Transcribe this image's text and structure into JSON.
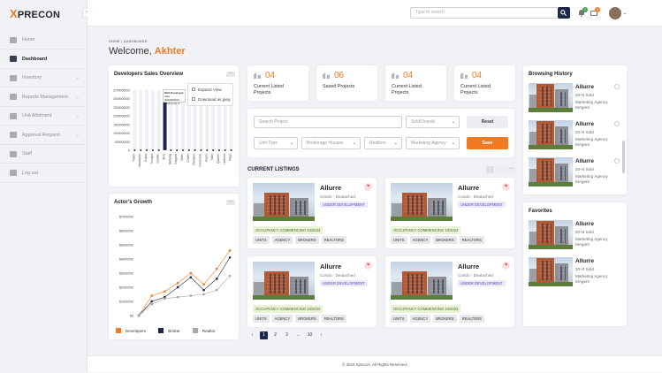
{
  "brand": {
    "logo_x": "X",
    "logo_text": "PRECON"
  },
  "sidebar": {
    "items": [
      {
        "label": "Home",
        "icon": "home-icon",
        "chevron": false
      },
      {
        "label": "Dashboard",
        "icon": "dashboard-icon",
        "chevron": false,
        "active": true
      },
      {
        "label": "Inventory",
        "icon": "inventory-icon",
        "chevron": true
      },
      {
        "label": "Reports Management",
        "icon": "reports-icon",
        "chevron": true
      },
      {
        "label": "Unit Allotment",
        "icon": "unit-icon",
        "chevron": true
      },
      {
        "label": "Approval Request",
        "icon": "approval-icon",
        "chevron": true
      },
      {
        "label": "Staff",
        "icon": "staff-icon",
        "chevron": false
      },
      {
        "label": "Log out",
        "icon": "logout-icon",
        "chevron": false
      }
    ]
  },
  "topbar": {
    "search_placeholder": "Type to search",
    "notif_count": "2",
    "msg_count": "3"
  },
  "breadcrumb": "HOME | DASHBOARD",
  "welcome": {
    "prefix": "Welcome,",
    "name": "Akhter"
  },
  "stats": [
    {
      "num": "04",
      "label": "Current Listed Projects"
    },
    {
      "num": "06",
      "label": "Saved Projects"
    },
    {
      "num": "04",
      "label": "Current Listed Projects"
    },
    {
      "num": "04",
      "label": "Current Listed Projects"
    }
  ],
  "sales": {
    "title": "Developers Sales Overview",
    "menu": [
      "Expand View",
      "Download as jpeg"
    ],
    "tooltip": [
      "BHS Developer",
      "Sale 3000000000",
      "Total Units: 3"
    ],
    "yticks": [
      "3700000000",
      "3000000000",
      "2500000000",
      "2000000000",
      "1500000000",
      "1000000000",
      "500000000",
      "0"
    ],
    "xticks": [
      "Tristar",
      "Hawthorne",
      "Gupta",
      "Triumph",
      "Granite",
      "BHS",
      "Mattamy",
      "Kingsett",
      "Minto",
      "Centre",
      "Phantom",
      "Fernbrook",
      "Aspen",
      "Talon",
      "Quarter",
      "Lanterra",
      "Plaza"
    ]
  },
  "chart_data": {
    "type": "bar",
    "title": "Developers Sales Overview",
    "categories": [
      "Tristar",
      "Hawthorne",
      "Gupta",
      "Triumph",
      "Granite",
      "BHS",
      "Mattamy",
      "Kingsett",
      "Minto",
      "Centre",
      "Phantom",
      "Fernbrook",
      "Aspen",
      "Talon",
      "Quarter",
      "Lanterra",
      "Plaza"
    ],
    "values": [
      0,
      0,
      0,
      0,
      0,
      3000000000,
      0,
      0,
      0,
      0,
      0,
      0,
      0,
      0,
      0,
      0,
      0
    ],
    "ylim": [
      0,
      3700000000
    ]
  },
  "growth": {
    "title": "Actor's Growth",
    "yticks": [
      "$7000000",
      "$6000000",
      "$5000000",
      "$4000000",
      "$3000000",
      "$2000000",
      "$1000000",
      "$0"
    ],
    "legend": [
      {
        "name": "Developers",
        "color": "#f27b21"
      },
      {
        "name": "Broker",
        "color": "#1e2749"
      },
      {
        "name": "Realtor",
        "color": "#a6a8ae"
      }
    ],
    "series": [
      {
        "name": "Developers",
        "values": [
          0,
          1400000,
          1700000,
          2300000,
          3000000,
          2200000,
          3300000,
          4600000
        ]
      },
      {
        "name": "Broker",
        "values": [
          0,
          1000000,
          1300000,
          2000000,
          2700000,
          1800000,
          2600000,
          4100000
        ]
      },
      {
        "name": "Realtor",
        "values": [
          0,
          800000,
          1200000,
          1300000,
          1400000,
          1500000,
          1800000,
          2800000
        ]
      }
    ]
  },
  "filters": {
    "search_project": "Search Project",
    "sold": "Sold/Unsold",
    "reset": "Reset",
    "unit_type": "Unit Type",
    "brokerage": "Brokerage Houses",
    "realtors": "Realtors",
    "agency": "Marketing Agency",
    "save": "Save"
  },
  "listings_title": "CURRENT LISTINGS",
  "listings": [
    {
      "name": "Allurre",
      "sub": "Condo - Deatached",
      "status": "UNDER DEVELOPMENT",
      "occ": "OCCUPANCY COMMENCING 10/2023",
      "tags": [
        "UNITS",
        "AGENCY",
        "BROKERS",
        "REALTORS"
      ]
    },
    {
      "name": "Allurre",
      "sub": "Condo - Deatached",
      "status": "UNDER DEVELOPMENT",
      "occ": "OCCUPANCY COMMENCING 10/2023",
      "tags": [
        "UNITS",
        "AGENCY",
        "BROKERS",
        "REALTORS"
      ]
    },
    {
      "name": "Allurre",
      "sub": "Condo - Deatached",
      "status": "UNDER DEVELOPMENT",
      "occ": "OCCUPANCY COMMENCING 10/2023",
      "tags": [
        "UNITS",
        "AGENCY",
        "BROKERS",
        "REALTORS"
      ]
    },
    {
      "name": "Allurre",
      "sub": "Condo - Deatached",
      "status": "UNDER DEVELOPMENT",
      "occ": "OCCUPANCY COMMENCING 10/2023",
      "tags": [
        "UNITS",
        "AGENCY",
        "BROKERS",
        "REALTORS"
      ]
    }
  ],
  "pagination": {
    "pages": [
      "1",
      "2",
      "3",
      "...",
      "10"
    ],
    "prev": "‹",
    "next": "›"
  },
  "browsing": {
    "title": "Browsing History",
    "items": [
      {
        "name": "Allurre",
        "sold": "20+0 Sold",
        "agency": "Marketing Agency",
        "agent": "MAgent"
      },
      {
        "name": "Allurre",
        "sold": "20+0 Sold",
        "agency": "Marketing Agency",
        "agent": "MAgent"
      },
      {
        "name": "Allurre",
        "sold": "20+0 Sold",
        "agency": "Marketing Agency",
        "agent": "MAgent"
      }
    ]
  },
  "favorites": {
    "title": "Favorites",
    "items": [
      {
        "name": "Allurre",
        "sold": "20+0 Sold",
        "agency": "Marketing Agency",
        "agent": "MAgent"
      },
      {
        "name": "Allurre",
        "sold": "20+0 Sold",
        "agency": "Marketing Agency",
        "agent": "MAgent"
      }
    ]
  },
  "footer": "© 2024 Xprecon. All Rights Reserved."
}
